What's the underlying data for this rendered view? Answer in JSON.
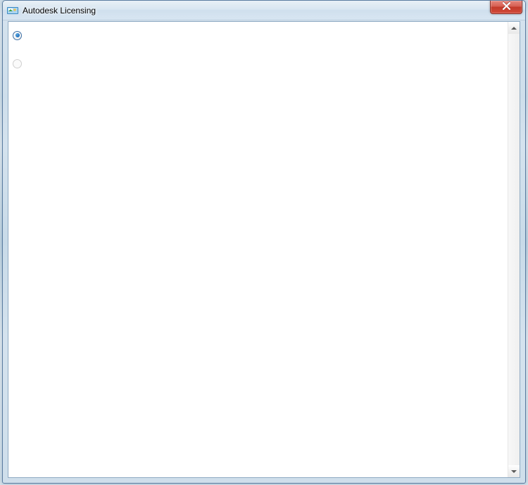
{
  "window": {
    "title": "Autodesk Licensing"
  },
  "options": [
    {
      "checked": true,
      "disabled": false
    },
    {
      "checked": false,
      "disabled": true
    }
  ]
}
